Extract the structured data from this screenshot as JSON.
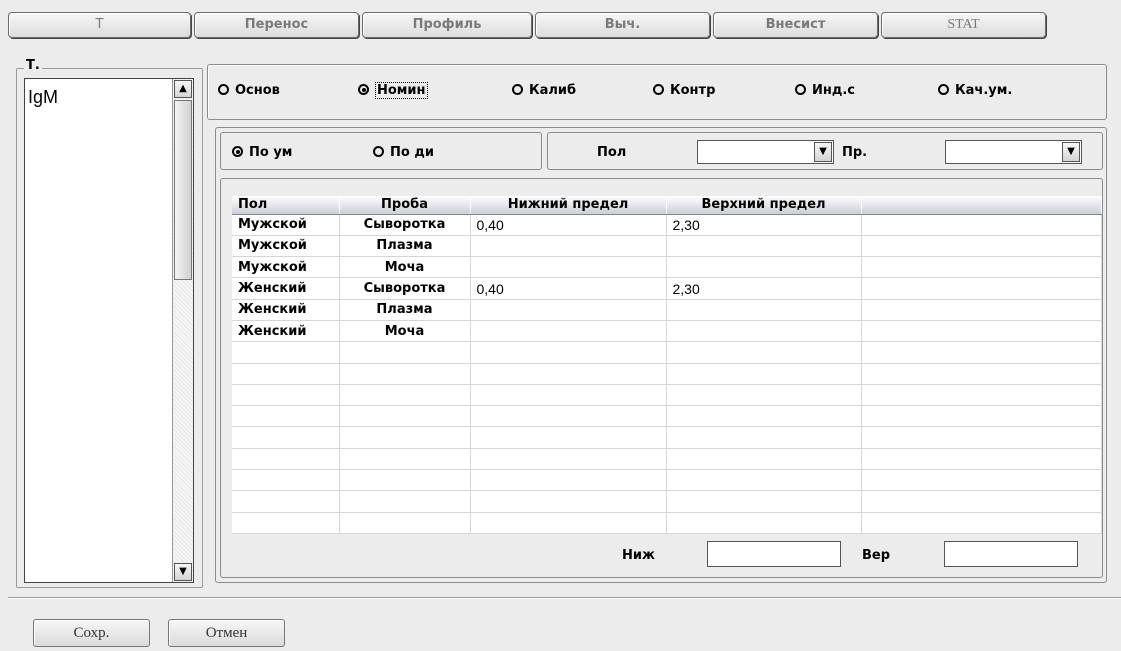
{
  "tabs": [
    {
      "label": "T"
    },
    {
      "label": "Перенос"
    },
    {
      "label": "Профиль"
    },
    {
      "label": "Выч."
    },
    {
      "label": "Внесист"
    },
    {
      "label": "STAT"
    }
  ],
  "tests_group": {
    "legend": "Т.",
    "items": [
      "IgM"
    ]
  },
  "range_type": {
    "options": [
      "Основ",
      "Номин",
      "Калиб",
      "Контр",
      "Инд.с",
      "Кач.ум."
    ],
    "selected": "Номин"
  },
  "filter": {
    "mode_options": [
      "По ум",
      "По ди"
    ],
    "mode_selected": "По ум",
    "sex_label": "Пол",
    "sex_value": "",
    "sample_label": "Пр.",
    "sample_value": ""
  },
  "grid": {
    "columns": [
      "Пол",
      "Проба",
      "Нижний предел",
      "Верхний предел",
      ""
    ],
    "rows": [
      [
        "Мужской",
        "Сыворотка",
        "0,40",
        "2,30",
        ""
      ],
      [
        "Мужской",
        "Плазма",
        "",
        "",
        ""
      ],
      [
        "Мужской",
        "Моча",
        "",
        "",
        ""
      ],
      [
        "Женский",
        "Сыворотка",
        "0,40",
        "2,30",
        ""
      ],
      [
        "Женский",
        "Плазма",
        "",
        "",
        ""
      ],
      [
        "Женский",
        "Моча",
        "",
        "",
        ""
      ]
    ],
    "empty_rows": 9
  },
  "limits": {
    "low_label": "Ниж",
    "low_value": "",
    "high_label": "Вер",
    "high_value": ""
  },
  "buttons": {
    "save": "Сохр.",
    "cancel": "Отмен"
  }
}
